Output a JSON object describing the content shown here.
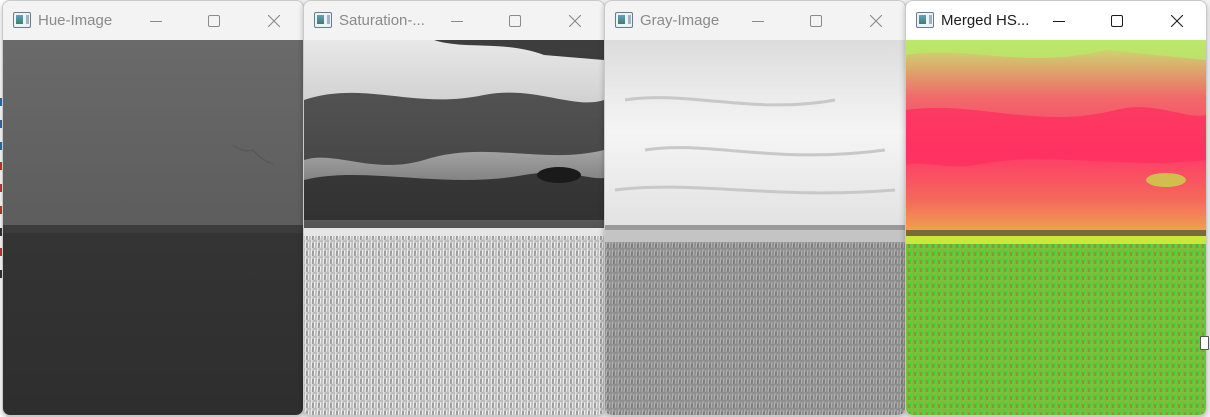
{
  "windows": [
    {
      "title": "Hue-Image",
      "active": false
    },
    {
      "title": "Saturation-...",
      "active": false
    },
    {
      "title": "Gray-Image",
      "active": false
    },
    {
      "title": "Merged HS...",
      "active": true
    }
  ],
  "controls": {
    "minimize_icon": "minimize-icon",
    "maximize_icon": "maximize-icon",
    "close_icon": "close-icon"
  },
  "colors": {
    "titlebar_active": "#ffffff",
    "titlebar_inactive": "#f3f3f3",
    "merged_sky": "#ff3b6a",
    "merged_field": "#3ed13a"
  }
}
